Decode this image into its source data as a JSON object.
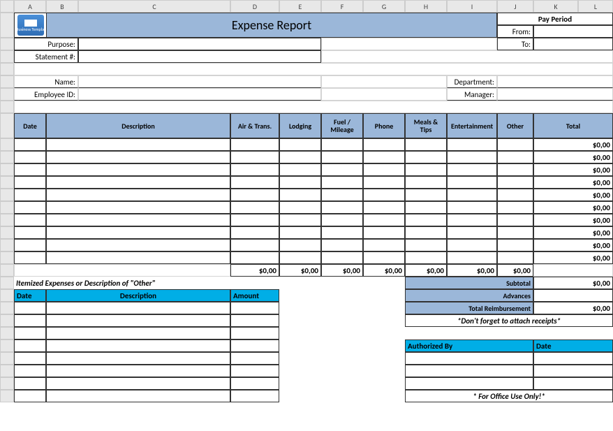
{
  "cols": [
    "A",
    "B",
    "C",
    "D",
    "E",
    "F",
    "G",
    "H",
    "I",
    "J",
    "K",
    "L"
  ],
  "title": "Expense Report",
  "logo_text": "AllBusiness Templates",
  "pay_period": {
    "heading": "Pay Period",
    "from": "From:",
    "to": "To:"
  },
  "labels": {
    "purpose": "Purpose:",
    "statement": "Statement #:",
    "name": "Name:",
    "employee": "Employee ID:",
    "department": "Department:",
    "manager": "Manager:"
  },
  "table": {
    "headers": [
      "Date",
      "Description",
      "Air & Trans.",
      "Lodging",
      "Fuel / Mileage",
      "Phone",
      "Meals & Tips",
      "Entertainment",
      "Other",
      "Total"
    ]
  },
  "zero": "$0,00",
  "summary": {
    "subtotal": "Subtotal",
    "advances": "Advances",
    "total": "Total Reimbursement",
    "reminder": "*Don't forget to attach receipts*"
  },
  "itemized": {
    "heading": "Itemized Expenses or Description of \"Other\"",
    "date": "Date",
    "desc": "Description",
    "amount": "Amount"
  },
  "auth": {
    "by": "Authorized By",
    "date": "Date",
    "office": "* For Office Use Only!*"
  }
}
